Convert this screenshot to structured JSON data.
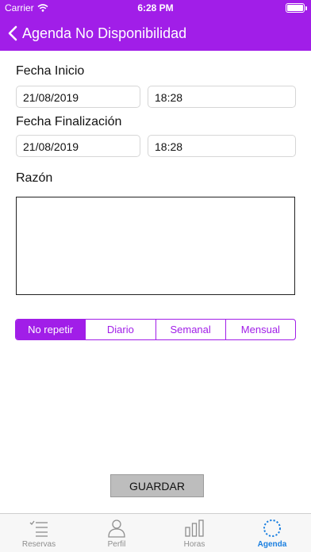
{
  "status_bar": {
    "carrier": "Carrier",
    "time": "6:28 PM"
  },
  "nav": {
    "title": "Agenda No Disponibilidad"
  },
  "form": {
    "start_label": "Fecha Inicio",
    "start_date": "21/08/2019",
    "start_time": "18:28",
    "end_label": "Fecha Finalización",
    "end_date": "21/08/2019",
    "end_time": "18:28",
    "reason_label": "Razón",
    "reason_value": ""
  },
  "repeat": {
    "options": [
      "No repetir",
      "Diario",
      "Semanal",
      "Mensual"
    ],
    "selected": "No repetir"
  },
  "save_label": "GUARDAR",
  "tabs": [
    {
      "label": "Reservas",
      "icon": "checklist-icon"
    },
    {
      "label": "Perfil",
      "icon": "person-icon"
    },
    {
      "label": "Horas",
      "icon": "bar-chart-icon"
    },
    {
      "label": "Agenda",
      "icon": "dotted-circle-icon"
    }
  ],
  "active_tab": "Agenda",
  "colors": {
    "accent": "#a11ee8",
    "tab_active": "#1a7fe0",
    "tab_inactive": "#8e8e8e"
  }
}
